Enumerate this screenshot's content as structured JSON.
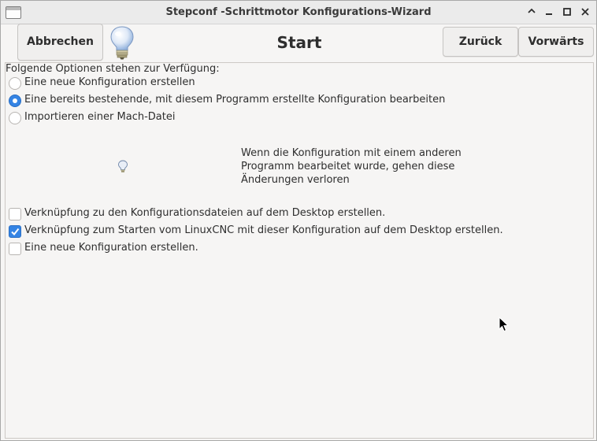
{
  "window": {
    "title": "Stepconf -Schrittmotor Konfigurations-Wizard",
    "controls": [
      "chevron-up-icon",
      "minimize-icon",
      "maximize-icon",
      "close-icon"
    ]
  },
  "header": {
    "cancel_label": "Abbrechen",
    "title": "Start",
    "back_label": "Zurück",
    "forward_label": "Vorwärts"
  },
  "options": {
    "intro": "Folgende Optionen stehen zur Verfügung:",
    "radios": [
      {
        "label": "Eine neue Konfiguration erstellen",
        "selected": false
      },
      {
        "label": "Eine bereits bestehende, mit diesem Programm erstellte Konfiguration bearbeiten",
        "selected": true
      },
      {
        "label": "Importieren einer Mach-Datei",
        "selected": false
      }
    ],
    "note_lines": [
      "Wenn die Konfiguration mit einem anderen",
      "Programm bearbeitet wurde, gehen diese",
      "Änderungen verloren"
    ],
    "checkboxes": [
      {
        "label": "Verknüpfung zu den Konfigurationsdateien auf dem Desktop erstellen.",
        "checked": false
      },
      {
        "label": "Verknüpfung zum Starten vom LinuxCNC mit dieser Konfiguration auf dem Desktop erstellen.",
        "checked": true
      },
      {
        "label": "Eine neue Konfiguration erstellen.",
        "checked": false
      }
    ]
  },
  "colors": {
    "accent": "#3584e4",
    "window_bg": "#f6f5f4",
    "titlebar_bg": "#ebebeb"
  }
}
